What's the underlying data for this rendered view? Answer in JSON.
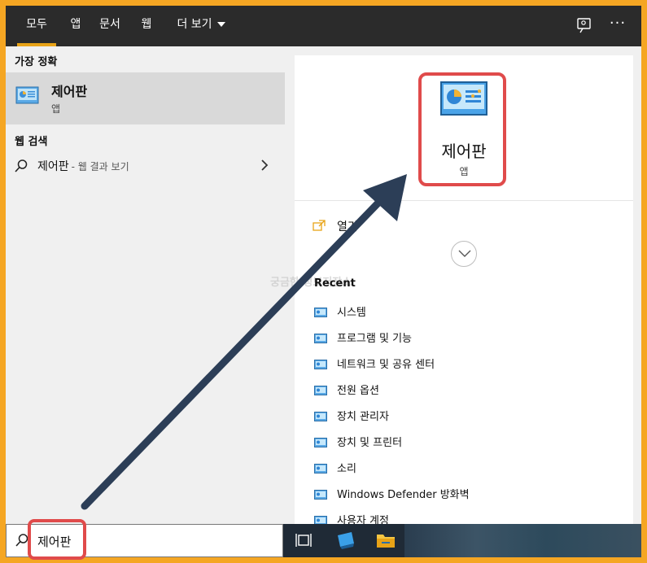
{
  "nav": {
    "tabs": [
      {
        "label": "모두",
        "active": true
      },
      {
        "label": "앱"
      },
      {
        "label": "문서"
      },
      {
        "label": "웹"
      },
      {
        "label": "더 보기"
      }
    ],
    "more_glyph": "···"
  },
  "best_match": {
    "heading": "가장 정확",
    "name": "제어판",
    "type": "앱"
  },
  "web_search": {
    "heading": "웹 검색",
    "term": "제어판",
    "suffix": "- 웹 결과 보기"
  },
  "detail": {
    "name": "제어판",
    "type": "앱",
    "open_label": "열기",
    "recent_heading": "Recent",
    "recent_items": [
      "시스템",
      "프로그램 및 기능",
      "네트워크 및 공유 센터",
      "전원 옵션",
      "장치 관리자",
      "장치 및 프린터",
      "소리",
      "Windows Defender 방화벽",
      "사용자 계정"
    ],
    "watermark": "궁금한 정보저장소"
  },
  "search": {
    "value": "제어판"
  },
  "colors": {
    "frame_border": "#f5a623",
    "highlight": "#e04b4b",
    "accent_tab": "#e8a317",
    "arrow": "#2c3e57"
  }
}
